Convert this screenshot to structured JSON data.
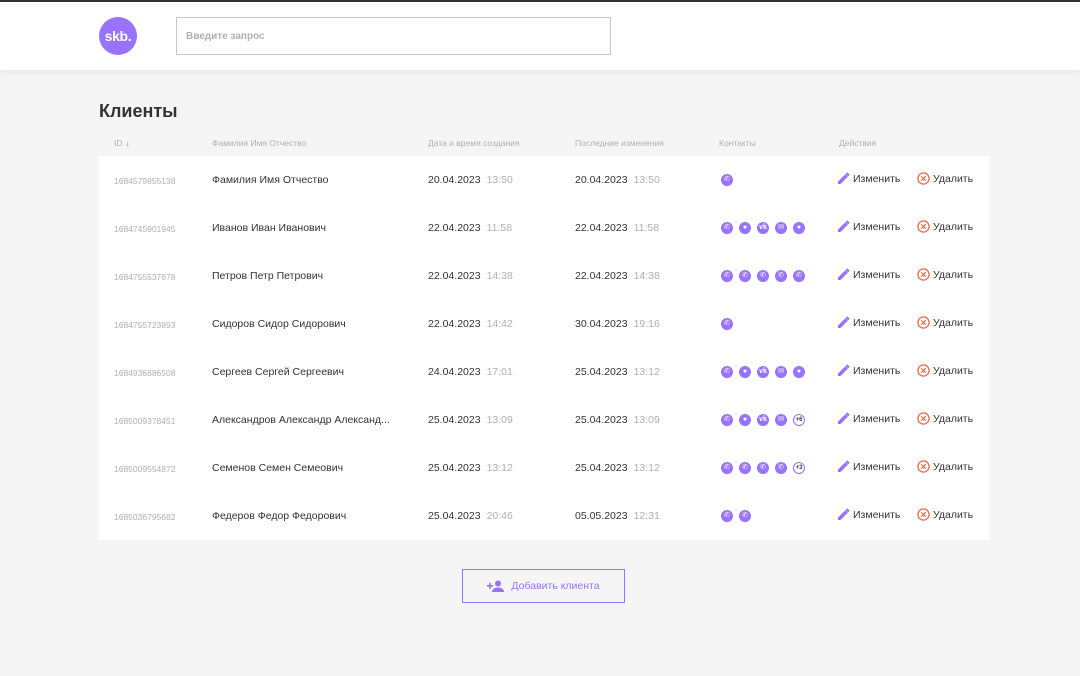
{
  "header": {
    "logo_text": "skb.",
    "search_placeholder": "Введите запрос"
  },
  "page_title": "Клиенты",
  "columns": {
    "id": "ID",
    "name": "Фамилия Имя Отчество",
    "created": "Дата и время создания",
    "updated": "Последние изменения",
    "contacts": "Контакты",
    "actions": "Действия"
  },
  "actions": {
    "edit_label": "Изменить",
    "delete_label": "Удалить"
  },
  "clients": [
    {
      "id": "1684579855138",
      "name": "Фамилия Имя Отчество",
      "created_date": "20.04.2023",
      "created_time": "13:50",
      "updated_date": "20.04.2023",
      "updated_time": "13:50",
      "contacts": [
        "phone"
      ]
    },
    {
      "id": "1684745901945",
      "name": "Иванов Иван Иванович",
      "created_date": "22.04.2023",
      "created_time": "11:58",
      "updated_date": "22.04.2023",
      "updated_time": "11:58",
      "contacts": [
        "phone",
        "user",
        "vk",
        "mail",
        "user"
      ]
    },
    {
      "id": "1684755537678",
      "name": "Петров Петр Петрович",
      "created_date": "22.04.2023",
      "created_time": "14:38",
      "updated_date": "22.04.2023",
      "updated_time": "14:38",
      "contacts": [
        "phone",
        "phone",
        "phone",
        "phone",
        "phone"
      ]
    },
    {
      "id": "1684755723893",
      "name": "Сидоров Сидор Сидорович",
      "created_date": "22.04.2023",
      "created_time": "14:42",
      "updated_date": "30.04.2023",
      "updated_time": "19:16",
      "contacts": [
        "phone"
      ]
    },
    {
      "id": "1684936886508",
      "name": "Сергеев Сергей Сергеевич",
      "created_date": "24.04.2023",
      "created_time": "17:01",
      "updated_date": "25.04.2023",
      "updated_time": "13:12",
      "contacts": [
        "phone",
        "user",
        "vk",
        "mail",
        "user"
      ]
    },
    {
      "id": "1685009378451",
      "name": "Александров Александр Александ...",
      "created_date": "25.04.2023",
      "created_time": "13:09",
      "updated_date": "25.04.2023",
      "updated_time": "13:09",
      "contacts": [
        "phone",
        "user",
        "vk",
        "mail",
        "+6"
      ]
    },
    {
      "id": "1685009554872",
      "name": "Семенов Семен Семеович",
      "created_date": "25.04.2023",
      "created_time": "13:12",
      "updated_date": "25.04.2023",
      "updated_time": "13:12",
      "contacts": [
        "phone",
        "phone",
        "phone",
        "phone",
        "+3"
      ]
    },
    {
      "id": "1685036795682",
      "name": "Федеров Федор Федорович",
      "created_date": "25.04.2023",
      "created_time": "20:46",
      "updated_date": "05.05.2023",
      "updated_time": "12:31",
      "contacts": [
        "phone",
        "phone"
      ]
    }
  ],
  "add_button_label": "Добавить клиента",
  "colors": {
    "accent": "#9873ff",
    "danger": "#f06a4d",
    "background": "#f5f5f5"
  }
}
